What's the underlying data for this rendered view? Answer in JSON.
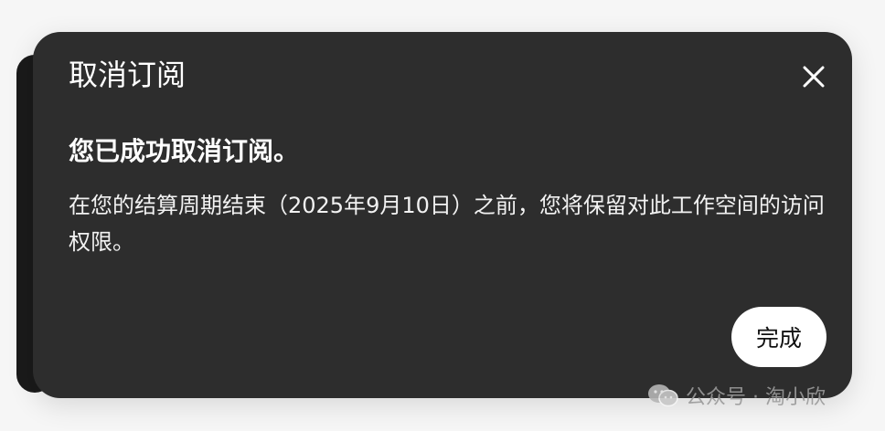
{
  "dialog": {
    "title": "取消订阅",
    "close_icon": "close-icon",
    "heading": "您已成功取消订阅。",
    "message": "在您的结算周期结束（2025年9月10日）之前，您将保留对此工作空间的访问权限。",
    "done_label": "完成",
    "colors": {
      "background": "#2d2d2d",
      "text": "#ffffff",
      "button_bg": "#ffffff",
      "button_text": "#111111"
    }
  },
  "watermark": {
    "icon": "wechat-icon",
    "text": "公众号 · 淘小欣"
  }
}
